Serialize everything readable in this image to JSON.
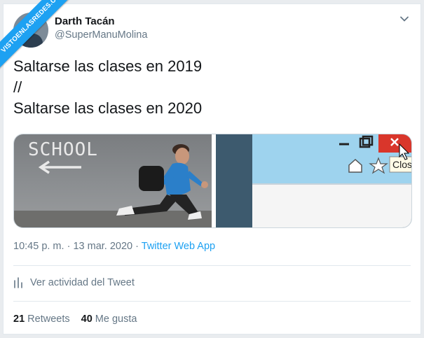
{
  "watermark": "VISTOENLASREDES.COM",
  "user": {
    "name": "Darth Tacán",
    "handle": "@SuperManuMolina"
  },
  "tweet": {
    "lines": [
      "Saltarse las clases en 2019",
      "//",
      "Saltarse las clases en 2020"
    ]
  },
  "media": {
    "left": {
      "wall_text": "SCHOOL"
    },
    "right": {
      "tooltip": "Close"
    }
  },
  "meta": {
    "time": "10:45 p. m.",
    "sep": "·",
    "date": "13 mar. 2020",
    "app": "Twitter Web App"
  },
  "activity_label": "Ver actividad del Tweet",
  "stats": {
    "retweets_count": "21",
    "retweets_label": "Retweets",
    "likes_count": "40",
    "likes_label": "Me gusta"
  },
  "colors": {
    "accent": "#1da1f2",
    "text": "#14171a",
    "muted": "#657786",
    "close_red": "#d9362b"
  }
}
